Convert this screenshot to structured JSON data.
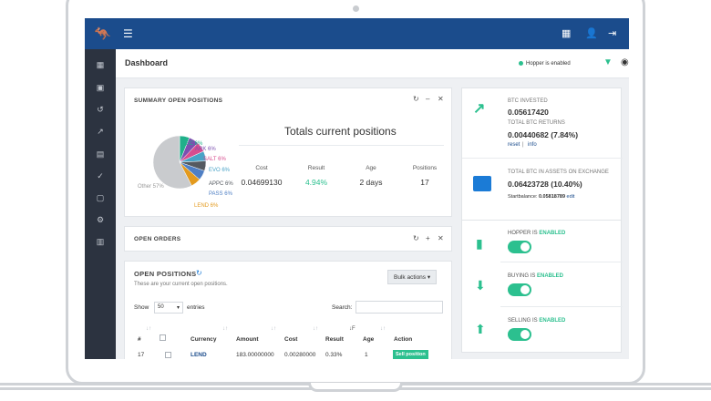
{
  "page": {
    "title": "Dashboard"
  },
  "header": {
    "hopper_status": "Hopper is enabled"
  },
  "summary": {
    "title": "SUMMARY OPEN POSITIONS",
    "totals_title": "Totals current positions",
    "labels": {
      "cost": "Cost",
      "result": "Result",
      "age": "Age",
      "positions": "Positions"
    },
    "values": {
      "cost": "0.04699130",
      "result": "4.94%",
      "age": "2 days",
      "positions": "17"
    }
  },
  "pie": {
    "slices": [
      {
        "name": "ZEC",
        "pct": "6%",
        "color": "#20b08a"
      },
      {
        "name": "ARK",
        "pct": "6%",
        "color": "#7b4fb0"
      },
      {
        "name": "SALT",
        "pct": "6%",
        "color": "#d84d8f"
      },
      {
        "name": "EVO",
        "pct": "6%",
        "color": "#49a3c7"
      },
      {
        "name": "APPC",
        "pct": "6%",
        "color": "#555a60"
      },
      {
        "name": "PASS",
        "pct": "6%",
        "color": "#4f7fc4"
      },
      {
        "name": "LEND",
        "pct": "6%",
        "color": "#e39a1e"
      },
      {
        "name": "Other",
        "pct": "57%",
        "color": "#c9cbce"
      }
    ]
  },
  "open_orders": {
    "title": "OPEN ORDERS"
  },
  "open_positions": {
    "title": "OPEN POSITIONS",
    "subtitle": "These are your current open positions.",
    "bulk_label": "Bulk actions ▾",
    "show_label": "Show",
    "show_value": "50",
    "entries_label": "entries",
    "search_label": "Search:",
    "columns": [
      "#",
      "Currency",
      "Amount",
      "Cost",
      "Result",
      "Age",
      "Action"
    ],
    "rows": [
      {
        "num": "17",
        "currency": "LEND",
        "amount": "183.00000000",
        "cost": "0.00280000",
        "result": "0.33%",
        "age": "1",
        "action": "Sell position"
      }
    ]
  },
  "btc": {
    "invested_label": "BTC INVESTED",
    "invested_value": "0.05617420",
    "returns_label": "TOTAL BTC RETURNS",
    "returns_value": "0.00440682 (7.84%)",
    "reset_link": "reset",
    "sep": "|",
    "info_link": "info",
    "exchange_label": "TOTAL BTC IN ASSETS ON EXCHANGE",
    "exchange_value": "0.06423728 (10.40%)",
    "startbalance_label": "Startbalance:",
    "startbalance_value": "0.05818789",
    "edit_link": "edit"
  },
  "toggles": [
    {
      "label": "HOPPER IS",
      "state": "ENABLED"
    },
    {
      "label": "BUYING IS",
      "state": "ENABLED"
    },
    {
      "label": "SELLING IS",
      "state": "ENABLED"
    }
  ]
}
